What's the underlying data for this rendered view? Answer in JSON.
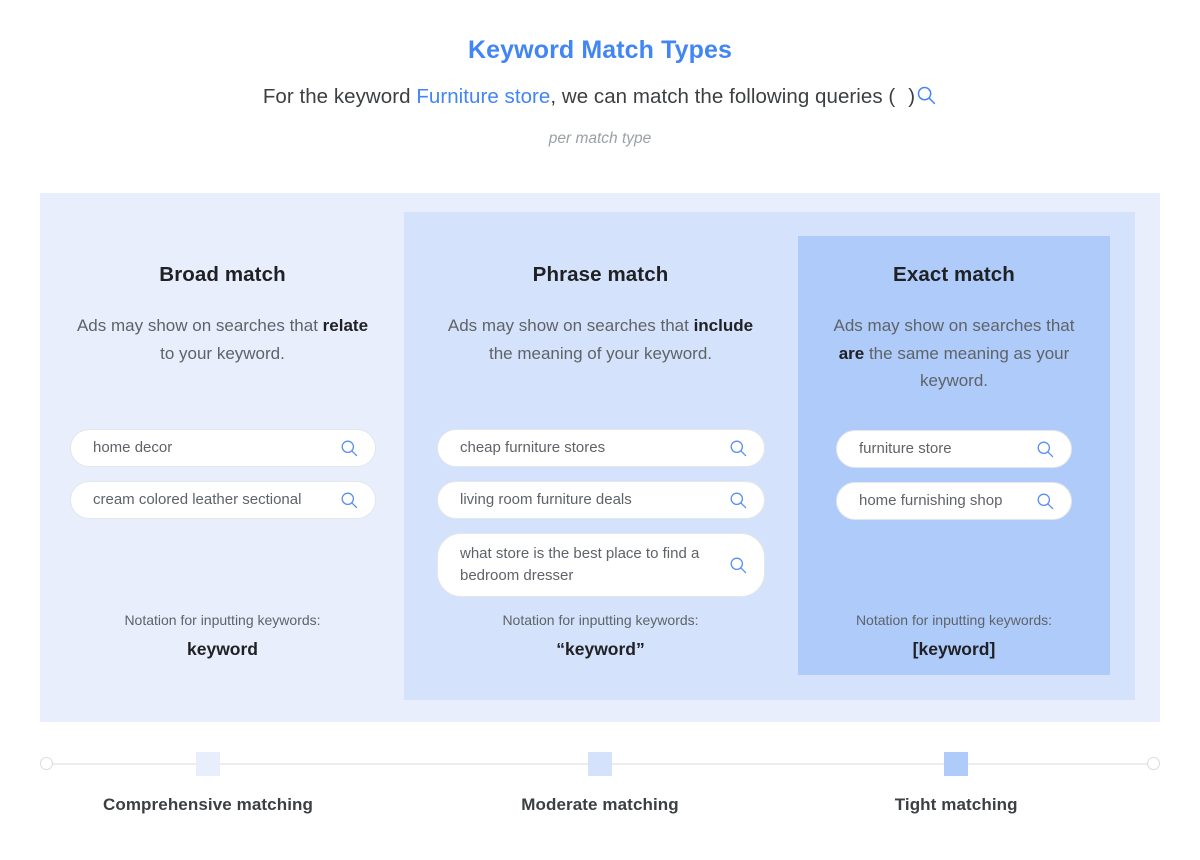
{
  "header": {
    "title": "Keyword Match Types",
    "subtitle_pre": "For the keyword ",
    "subtitle_keyword": "Furniture store",
    "subtitle_post": ", we can match the following queries (",
    "subtitle_close": ")",
    "search_icon": "search-icon",
    "sub_note": "per match type"
  },
  "columns": [
    {
      "id": "broad",
      "title": "Broad match",
      "desc_parts": [
        "Ads may show on searches that ",
        "relate",
        " to your keyword."
      ],
      "desc_plain": "Ads may show on searches that relate to your keyword.",
      "queries": [
        {
          "text": "home decor",
          "icon": "search-icon"
        },
        {
          "text": "cream colored leather sectional",
          "icon": "search-icon"
        }
      ],
      "notation_label": "Notation for inputting keywords:",
      "notation_value": "keyword",
      "bg_color": "#e8eefc"
    },
    {
      "id": "phrase",
      "title": "Phrase match",
      "desc_parts": [
        "Ads may show on searches that ",
        "include",
        " the meaning of your keyword."
      ],
      "desc_plain": "Ads may show on searches that include the meaning of your keyword.",
      "queries": [
        {
          "text": "cheap furniture stores",
          "icon": "search-icon"
        },
        {
          "text": "living room furniture deals",
          "icon": "search-icon"
        },
        {
          "text": "what store is the best place to find a bedroom dresser",
          "icon": "search-icon"
        }
      ],
      "notation_label": "Notation for inputting keywords:",
      "notation_value": "“keyword”",
      "bg_color": "#d4e3fb"
    },
    {
      "id": "exact",
      "title": "Exact match",
      "desc_parts": [
        "Ads may show on searches that ",
        "are",
        " the same meaning as your keyword."
      ],
      "desc_plain": "Ads may show on searches that are the same meaning as your keyword.",
      "queries": [
        {
          "text": "furniture store",
          "icon": "search-icon"
        },
        {
          "text": "home furnishing shop",
          "icon": "search-icon"
        }
      ],
      "notation_label": "Notation for inputting keywords:",
      "notation_value": "[keyword]",
      "bg_color": "#aecbfa"
    }
  ],
  "scale": {
    "markers": [
      {
        "label": "Comprehensive matching",
        "color": "#e8eefc",
        "position_pct": 15.0
      },
      {
        "label": "Moderate matching",
        "color": "#d4e3fb",
        "position_pct": 50.0
      },
      {
        "label": "Tight matching",
        "color": "#aecbfa",
        "position_pct": 81.8
      }
    ],
    "endpoint_left": "scale-endpoint-circle",
    "endpoint_right": "scale-endpoint-circle"
  },
  "theme": {
    "accent": "#4285f4",
    "title_color": "#4285f4",
    "body_text": "#5f6368",
    "strong_text": "#202124",
    "muted_text": "#9aa0a6",
    "pill_bg": "#ffffff",
    "pill_border": "#e3e6ea",
    "line_color": "#ebedef"
  }
}
